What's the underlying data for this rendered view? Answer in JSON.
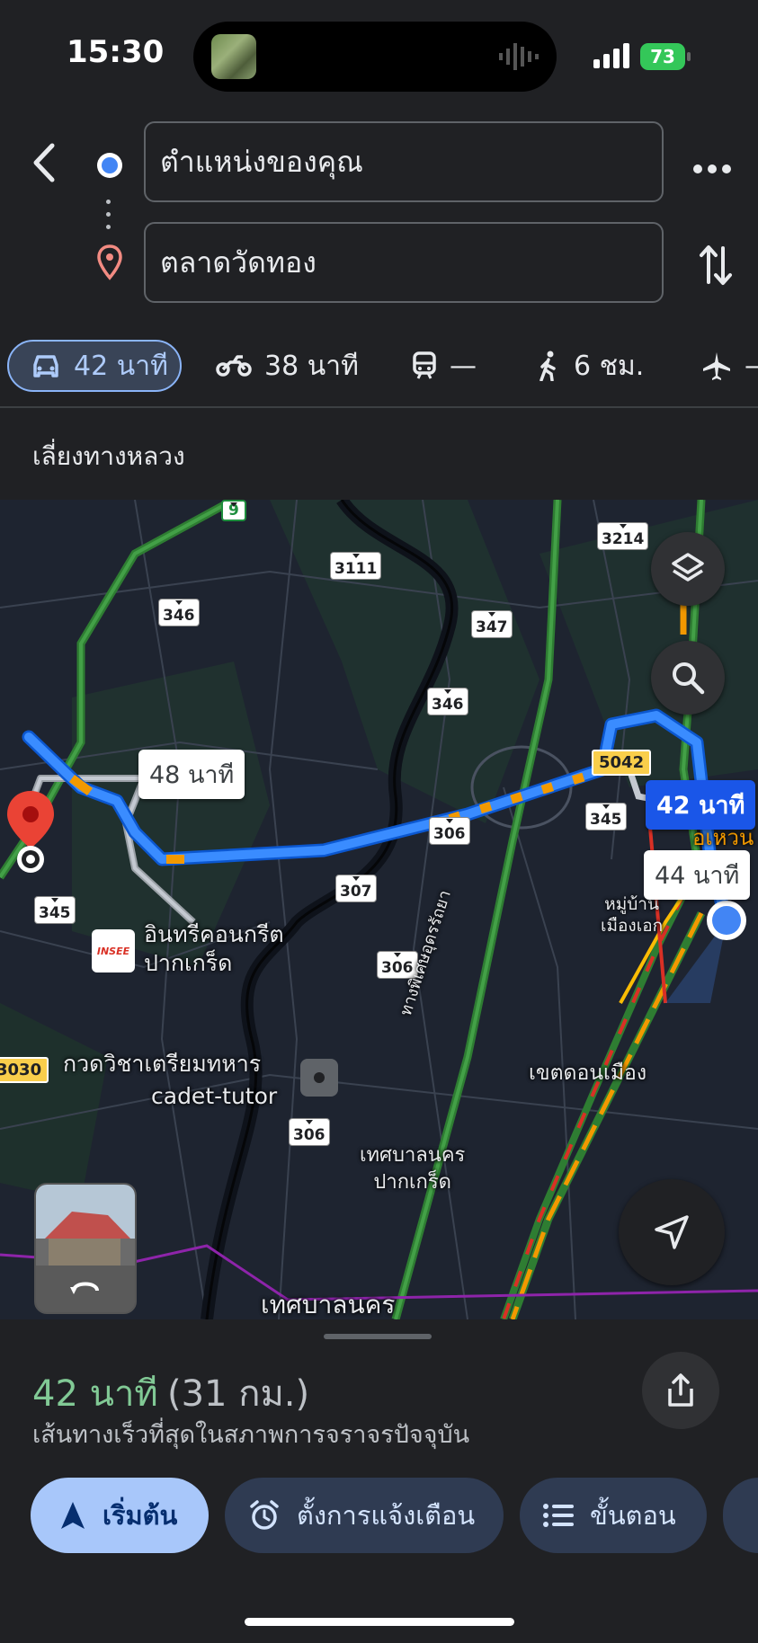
{
  "status_bar": {
    "time": "15:30",
    "battery": "73"
  },
  "route_inputs": {
    "origin": "ตำแหน่งของคุณ",
    "destination": "ตลาดวัดทอง"
  },
  "modes": [
    {
      "id": "car",
      "label": "42 นาที",
      "selected": true
    },
    {
      "id": "motorbike",
      "label": "38 นาที"
    },
    {
      "id": "transit",
      "label": "—"
    },
    {
      "id": "walk",
      "label": "6 ชม."
    },
    {
      "id": "flight",
      "label": "—"
    }
  ],
  "route_note": "เลี่ยงทางหลวง",
  "map": {
    "callouts": {
      "primary": "42 นาที",
      "alt1": "48 นาที",
      "alt2": "44 นาที"
    },
    "labels": {
      "insee": "อินทรีคอนกรีต\nปากเกร็ด",
      "tutor_th": "กวดวิชาเตรียมทหาร",
      "tutor_en": "cadet-tutor",
      "muni1": "เทศบาลนคร\nปากเกร็ด",
      "muni2": "เทศบาลนคร",
      "donmueang": "เขตดอนเมือง",
      "village": "หมู่บ้าน\nเมืองเอก",
      "road": "ทางพิเศษอุดรรัถยา",
      "partial": "อเหวน"
    },
    "shields": [
      "3214",
      "3111",
      "346",
      "347",
      "346",
      "306",
      "307",
      "306",
      "306",
      "345",
      "345",
      "9"
    ],
    "yellow_shields": [
      "5042",
      "3030"
    ],
    "brand_logo": "INSEE"
  },
  "summary": {
    "duration": "42 นาที",
    "distance": "(31 กม.)",
    "subtitle": "เส้นทางเร็วที่สุดในสภาพการจราจรปัจจุบัน"
  },
  "actions": {
    "start": "เริ่มต้น",
    "reminder": "ตั้งการแจ้งเตือน",
    "steps": "ขั้นตอน"
  },
  "colors": {
    "route": "#1a73e8",
    "primary_button": "#a8c7fa",
    "duration": "#81c995",
    "traffic_slow": "#f29900",
    "traffic_jam": "#d93025"
  }
}
